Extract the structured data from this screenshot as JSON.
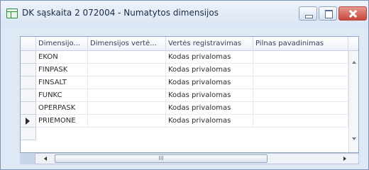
{
  "window": {
    "title": "DK sąskaita 2 072004 - Numatytos dimensijos"
  },
  "grid": {
    "columns": [
      "Dimensijo...",
      "Dimensijos vertė...",
      "Vertės registravimas",
      "Pilnas pavadinimas"
    ],
    "rows": [
      {
        "dimension": "EKON",
        "value": "",
        "posting": "Kodas privalomas",
        "name": ""
      },
      {
        "dimension": "FINPASK",
        "value": "",
        "posting": "Kodas privalomas",
        "name": ""
      },
      {
        "dimension": "FINSALT",
        "value": "",
        "posting": "Kodas privalomas",
        "name": ""
      },
      {
        "dimension": "FUNKC",
        "value": "",
        "posting": "Kodas privalomas",
        "name": ""
      },
      {
        "dimension": "OPERPASK",
        "value": "",
        "posting": "Kodas privalomas",
        "name": ""
      },
      {
        "dimension": "PRIEMONE",
        "value": "",
        "posting": "Kodas privalomas",
        "name": ""
      }
    ]
  },
  "scrollbar": {
    "thumb_grip": "III"
  }
}
